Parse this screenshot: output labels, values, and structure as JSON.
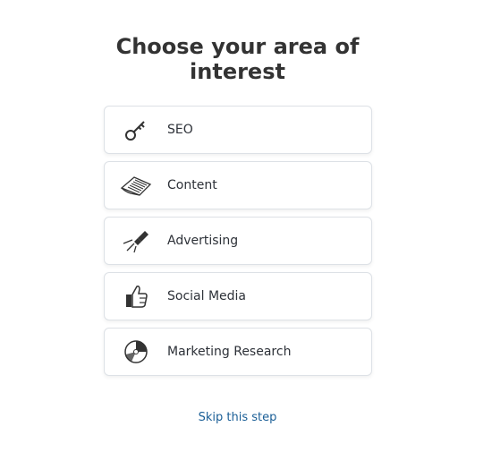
{
  "heading": {
    "line1": "Choose your area of",
    "line2": "interest"
  },
  "options": [
    {
      "label": "SEO",
      "icon": "key-icon"
    },
    {
      "label": "Content",
      "icon": "document-icon"
    },
    {
      "label": "Advertising",
      "icon": "flashlight-icon"
    },
    {
      "label": "Social Media",
      "icon": "thumbs-up-icon"
    },
    {
      "label": "Marketing Research",
      "icon": "pie-chart-icon"
    }
  ],
  "skip": {
    "label": "Skip this step"
  },
  "colors": {
    "link": "#1a5e96",
    "border": "#dde1e6",
    "text": "#2d3138"
  }
}
